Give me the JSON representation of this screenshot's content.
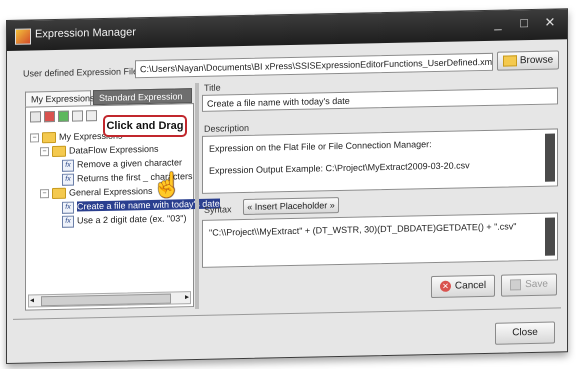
{
  "window": {
    "title": "Expression Manager",
    "minimize": "_",
    "maximize": "□",
    "close": "✕"
  },
  "file": {
    "label": "User defined Expression File",
    "path": "C:\\Users\\Nayan\\Documents\\BI xPress\\SSISExpressionEditorFunctions_UserDefined.xml",
    "browse_label": "Browse"
  },
  "tabs": [
    "My Expressions",
    "Standard Expression"
  ],
  "tree": {
    "root": "My Expressions",
    "groups": [
      {
        "name": "DataFlow Expressions",
        "items": [
          "Remove a given character",
          "Returns the first _ characters"
        ]
      },
      {
        "name": "General Expressions",
        "items": [
          "Create a file name with today's date",
          "Use a 2 digit date (ex. \"03\")"
        ]
      }
    ]
  },
  "callout": "Click and Drag",
  "detail": {
    "title_label": "Title",
    "title_value": "Create a file name with today's date",
    "description_label": "Description",
    "description_line1": "Expression on the Flat File or File Connection Manager:",
    "description_line2": "Expression Output Example: C:\\Project\\MyExtract2009-03-20.csv",
    "syntax_label": "Syntax",
    "insert_placeholder": "« Insert Placeholder »",
    "syntax_value": "\"C:\\\\Project\\\\MyExtract\" + (DT_WSTR, 30)(DT_DBDATE)GETDATE() + \".csv\""
  },
  "buttons": {
    "cancel": "Cancel",
    "save": "Save",
    "close": "Close"
  }
}
